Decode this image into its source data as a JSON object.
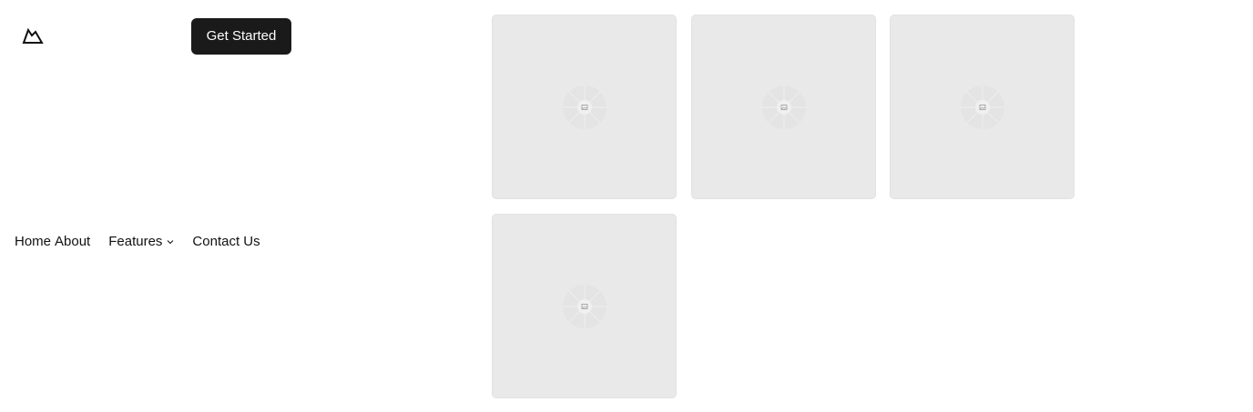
{
  "header": {
    "logo_icon": "mountain-logo-icon",
    "cta_label": "Get Started",
    "cta_color": "#1a1a1a"
  },
  "nav": {
    "items": [
      {
        "label": "Home"
      },
      {
        "label": "About"
      },
      {
        "label": "Features",
        "icon": "chevron-down-icon"
      },
      {
        "label": "Contact Us"
      }
    ]
  },
  "gallery": {
    "tiles": [
      {
        "icon": "image-placeholder-icon"
      },
      {
        "icon": "image-placeholder-icon"
      },
      {
        "icon": "image-placeholder-icon"
      },
      {
        "icon": "image-placeholder-icon"
      }
    ],
    "tile_color": "#e9e9e9"
  }
}
